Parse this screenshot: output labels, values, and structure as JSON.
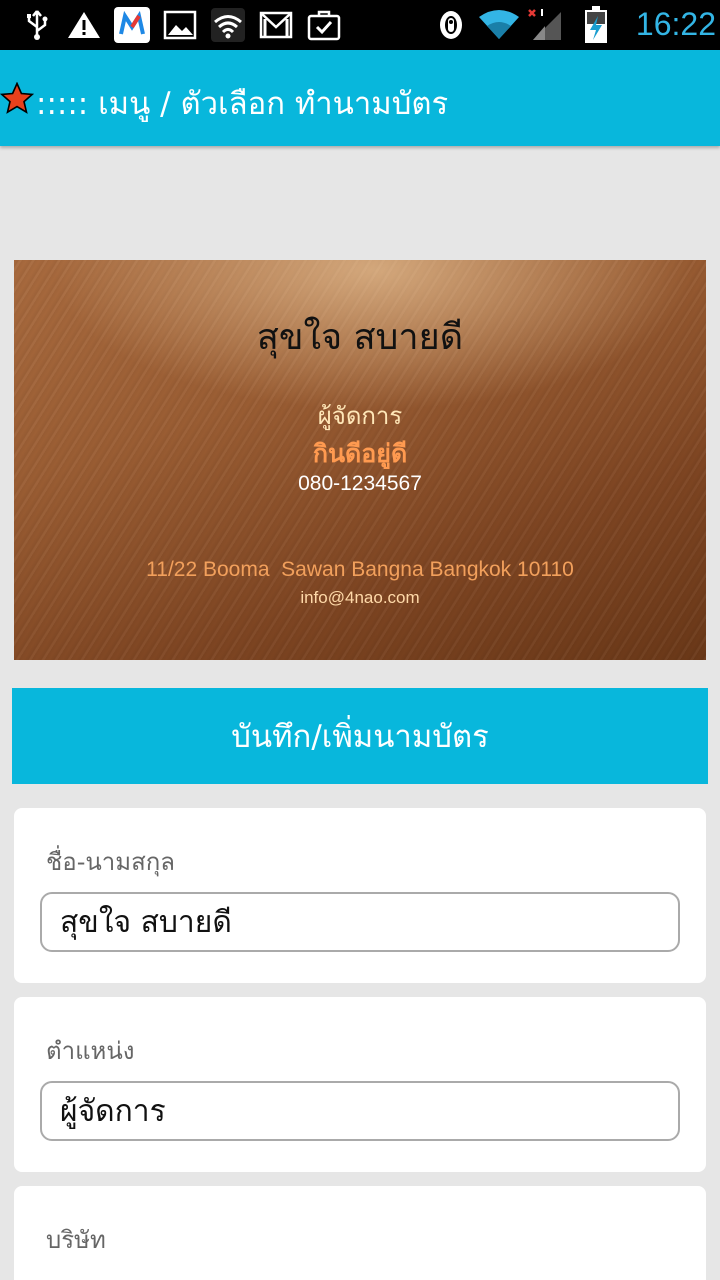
{
  "status_bar": {
    "time": "16:22",
    "icons": [
      "usb-icon",
      "warning-icon",
      "m-app-icon",
      "gallery-icon",
      "wifi-app-icon",
      "gmail-icon",
      "task-icon",
      "alarm-icon",
      "wifi-signal-icon",
      "cell-signal-icon",
      "battery-charging-icon"
    ]
  },
  "action_bar": {
    "title": "::::: เมนู / ตัวเลือก ทำนามบัตร",
    "icon": "star-icon"
  },
  "card": {
    "name": "สุขใจ สบายดี",
    "position": "ผู้จัดการ",
    "company": "กินดีอยู่ดี",
    "phone": "080-1234567",
    "address": "11/22 Booma  Sawan Bangna Bangkok 10110",
    "email": "info@4nao.com"
  },
  "save_button": {
    "label": "บันทึก/เพิ่มนามบัตร"
  },
  "form": {
    "name_label": "ชื่อ-นามสกุล",
    "name_value": "สุขใจ สบายดี",
    "position_label": "ตำแหน่ง",
    "position_value": "ผู้จัดการ",
    "company_label": "บริษัท"
  },
  "colors": {
    "accent": "#08b7dc",
    "status_time": "#33b5e5",
    "company_text": "#ff9a50"
  }
}
